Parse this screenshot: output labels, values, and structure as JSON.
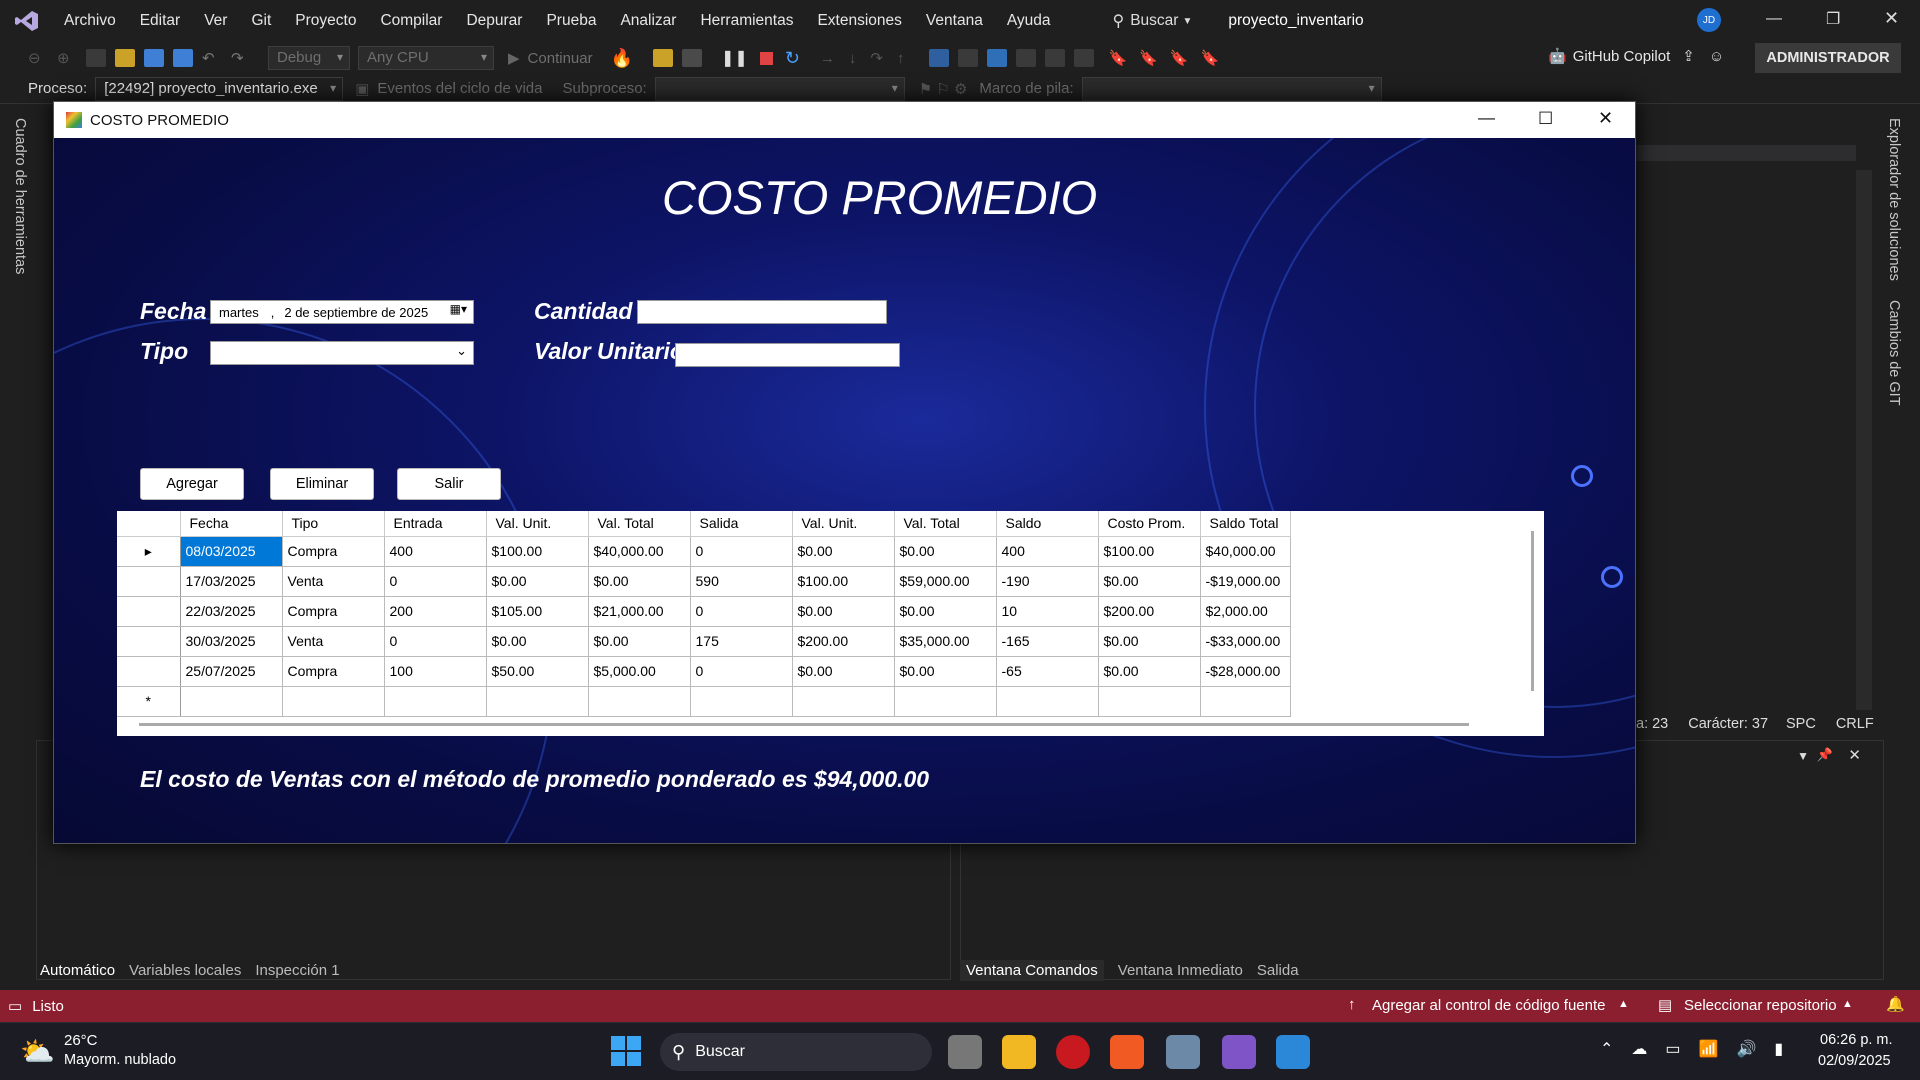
{
  "vs": {
    "menu": [
      "Archivo",
      "Editar",
      "Ver",
      "Git",
      "Proyecto",
      "Compilar",
      "Depurar",
      "Prueba",
      "Analizar",
      "Herramientas",
      "Extensiones",
      "Ventana",
      "Ayuda"
    ],
    "search": "Buscar",
    "solution": "proyecto_inventario",
    "avatar": "JD",
    "config": "Debug",
    "platform": "Any CPU",
    "continue": "Continuar",
    "copilot": "GitHub Copilot",
    "admin": "ADMINISTRADOR",
    "proc_label": "Proceso:",
    "proc_value": "[22492] proyecto_inventario.exe",
    "lifecycle": "Eventos del ciclo de vida",
    "subproc": "Subproceso:",
    "stackframe": "Marco de pila:",
    "left_vtab": "Cuadro de herramientas",
    "right_vtab1": "Explorador de soluciones",
    "right_vtab2": "Cambios de GIT",
    "editor_status": {
      "line": "a: 23",
      "char": "Carácter: 37",
      "spc": "SPC",
      "crlf": "CRLF"
    },
    "bottom_left_tabs": [
      "Automático",
      "Variables locales",
      "Inspección 1"
    ],
    "bottom_right_tabs": [
      "Ventana Comandos",
      "Ventana Inmediato",
      "Salida"
    ],
    "status_ready": "Listo",
    "status_source": "Agregar al control de código fuente",
    "status_repo": "Seleccionar repositorio"
  },
  "form": {
    "window_title": "COSTO PROMEDIO",
    "heading": "COSTO PROMEDIO",
    "fecha_label": "Fecha",
    "fecha_day": "martes",
    "fecha_sep": ",",
    "fecha_date": "2 de septiembre de 2025",
    "tipo_label": "Tipo",
    "tipo_value": "",
    "cantidad_label": "Cantidad",
    "cantidad_value": "",
    "valor_label": "Valor Unitario",
    "valor_value": "",
    "btn_agregar": "Agregar",
    "btn_eliminar": "Eliminar",
    "btn_salir": "Salir",
    "grid": {
      "columns": [
        "Fecha",
        "Tipo",
        "Entrada",
        "Val. Unit.",
        "Val. Total",
        "Salida",
        "Val. Unit.",
        "Val. Total",
        "Saldo",
        "Costo Prom.",
        "Saldo Total"
      ],
      "rows": [
        [
          "08/03/2025",
          "Compra",
          "400",
          "$100.00",
          "$40,000.00",
          "0",
          "$0.00",
          "$0.00",
          "400",
          "$100.00",
          "$40,000.00"
        ],
        [
          "17/03/2025",
          "Venta",
          "0",
          "$0.00",
          "$0.00",
          "590",
          "$100.00",
          "$59,000.00",
          "-190",
          "$0.00",
          "-$19,000.00"
        ],
        [
          "22/03/2025",
          "Compra",
          "200",
          "$105.00",
          "$21,000.00",
          "0",
          "$0.00",
          "$0.00",
          "10",
          "$200.00",
          "$2,000.00"
        ],
        [
          "30/03/2025",
          "Venta",
          "0",
          "$0.00",
          "$0.00",
          "175",
          "$200.00",
          "$35,000.00",
          "-165",
          "$0.00",
          "-$33,000.00"
        ],
        [
          "25/07/2025",
          "Compra",
          "100",
          "$50.00",
          "$5,000.00",
          "0",
          "$0.00",
          "$0.00",
          "-65",
          "$0.00",
          "-$28,000.00"
        ]
      ],
      "current_row_marker": "▸",
      "new_row_marker": "*"
    },
    "result": "El costo de Ventas con el método de promedio ponderado es $94,000.00"
  },
  "taskbar": {
    "temp": "26°C",
    "weather": "Mayorm. nublado",
    "search": "Buscar",
    "time": "06:26 p. m.",
    "date": "02/09/2025"
  },
  "colors": {
    "status_bar": "#8b1e2f",
    "selection": "#0078d7",
    "form_bg": "#0b1050"
  }
}
